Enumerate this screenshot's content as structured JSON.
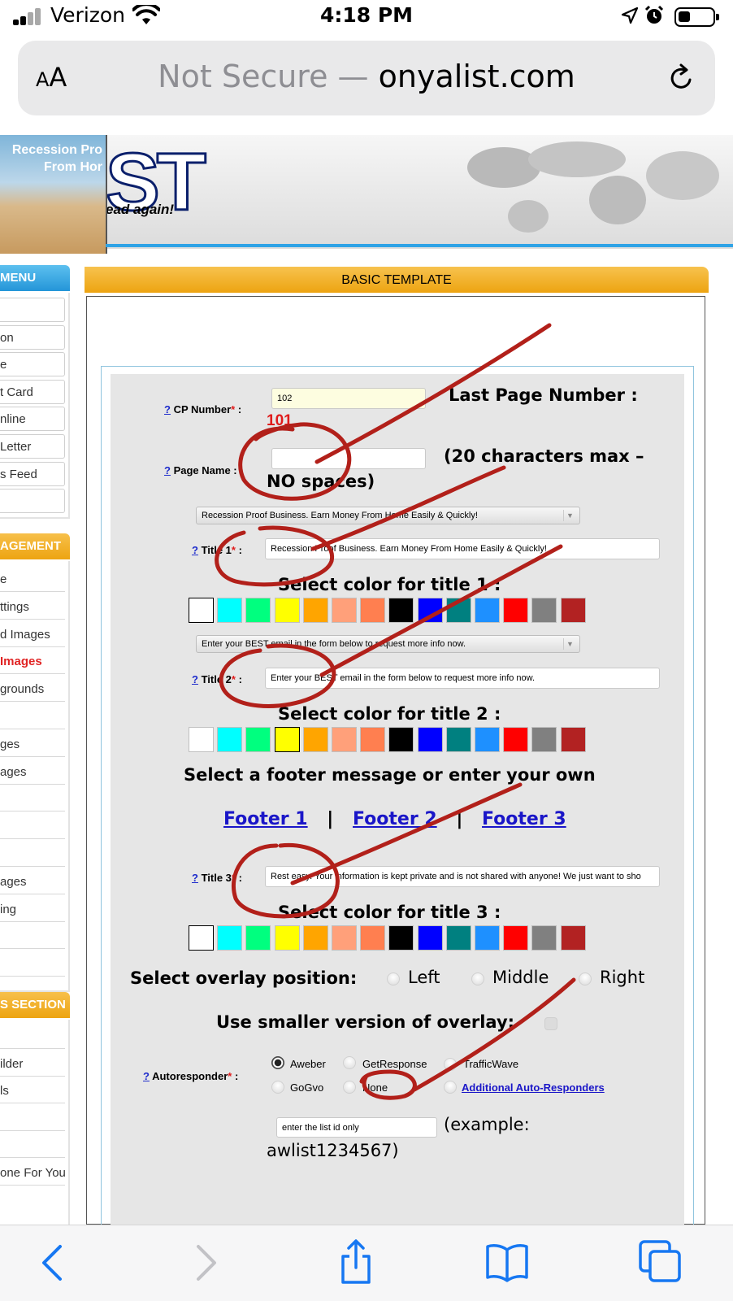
{
  "status_bar": {
    "carrier": "Verizon",
    "time": "4:18 PM",
    "battery_level": 0.35
  },
  "address_bar": {
    "text_size_label_large": "A",
    "text_size_label_small": "A",
    "not_secure": "Not Secure —",
    "domain": "onyalist.com",
    "reload_icon": "reload-icon"
  },
  "banner": {
    "photo_text_line1": "Recession Pro",
    "photo_text_line2": "From Hor",
    "logo_text": "ST",
    "slogan": "ead again!"
  },
  "sidebar": {
    "menu_header": "MENU",
    "menu_items": [
      "",
      "on",
      "e",
      "t Card",
      "nline",
      "Letter",
      "s Feed",
      ""
    ],
    "management_header": "AGEMENT",
    "management_items": [
      "e",
      "ttings",
      "d Images",
      "Images",
      "grounds",
      "",
      "ges",
      "ages",
      "",
      "",
      "",
      "ages",
      "ing",
      "",
      ""
    ],
    "section_header": "S SECTION",
    "section_items": [
      "",
      "ilder",
      "ls",
      "",
      "",
      "one For You"
    ]
  },
  "main": {
    "header": "BASIC TEMPLATE",
    "cp_number": {
      "help": "?",
      "label": "CP Number",
      "required": "*",
      "colon": " :",
      "value": "102",
      "last_page_label": "Last Page Number :",
      "last_page_value": "101"
    },
    "page_name": {
      "help": "?",
      "label": "Page Name",
      "required": "",
      "colon": " :",
      "value": "",
      "hint_line1": "(20 characters max –",
      "hint_line2": "NO spaces)"
    },
    "title1": {
      "dropdown": "Recession Proof Business. Earn Money From Home Easily & Quickly!",
      "help": "?",
      "label": "Title 1",
      "required": "*",
      "colon": " :",
      "value": "Recession Proof Business. Earn Money From Home Easily & Quickly!",
      "color_label": "Select color for title 1 :"
    },
    "title2": {
      "dropdown": "Enter your BEST email in the form below to request more info now.",
      "help": "?",
      "label": "Title 2",
      "required": "*",
      "colon": " :",
      "value": "Enter your BEST email in the form below to request more info now.",
      "color_label": "Select color for title 2 :"
    },
    "footer": {
      "heading": "Select a footer message or enter your own",
      "links": [
        "Footer 1",
        "Footer 2",
        "Footer 3"
      ],
      "separator": "|"
    },
    "title3": {
      "help": "?",
      "label": "Title 3",
      "required": "*",
      "colon": " :",
      "value": "Rest easy. Your information is kept private and is not shared with anyone! We just want to sho",
      "color_label": "Select color for title 3 :"
    },
    "swatch_colors": [
      "#ffffff",
      "#00ffff",
      "#00ff7f",
      "#ffff00",
      "#ffa500",
      "#ffa07a",
      "#ff7f50",
      "#000000",
      "#0000ff",
      "#008080",
      "#1e90ff",
      "#ff0000",
      "#808080",
      "#b22222"
    ],
    "title1_selected_color": "#ffffff",
    "title2_selected_color": "#ffff00",
    "title3_selected_color": "#ffffff",
    "overlay": {
      "label": "Select overlay position:",
      "options": [
        "Left",
        "Middle",
        "Right"
      ]
    },
    "smaller_overlay": {
      "label": "Use smaller version of overlay:"
    },
    "autoresponder": {
      "help": "?",
      "label": "Autoresponder",
      "required": "*",
      "colon": " :",
      "options": [
        "Aweber",
        "GetResponse",
        "TrafficWave",
        "GoGvo",
        "None",
        "Additional Auto-Responders"
      ],
      "selected": "Aweber",
      "list_id_placeholder": "enter the list id only",
      "example_line1": "(example:",
      "example_line2": "awlist1234567)"
    }
  },
  "toolbar": {
    "icons": [
      "back-icon",
      "forward-icon",
      "share-icon",
      "bookmarks-icon",
      "tabs-icon"
    ]
  },
  "colors": {
    "accent_orange": "#eda411",
    "accent_blue": "#2495d8",
    "link_blue": "#1a16c8",
    "annotation_red": "#b2201a"
  }
}
